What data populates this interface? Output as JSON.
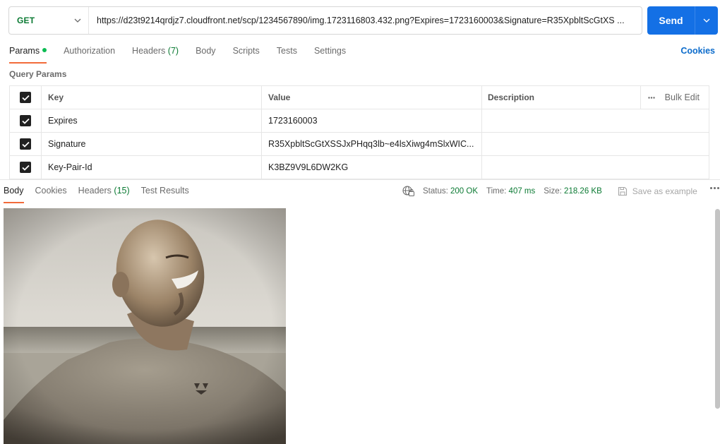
{
  "request": {
    "method": "GET",
    "url": "https://d23t9214qrdjz7.cloudfront.net/scp/1234567890/img.1723116803.432.png?Expires=1723160003&Signature=R35XpbltScGtXS ...",
    "send_label": "Send"
  },
  "request_tabs": [
    {
      "label": "Params",
      "active": true
    },
    {
      "label": "Authorization"
    },
    {
      "label": "Headers",
      "count": "(7)"
    },
    {
      "label": "Body"
    },
    {
      "label": "Scripts"
    },
    {
      "label": "Tests"
    },
    {
      "label": "Settings"
    }
  ],
  "cookies_label": "Cookies",
  "query_params": {
    "title": "Query Params",
    "headers": {
      "key": "Key",
      "value": "Value",
      "description": "Description",
      "bulk_edit": "Bulk Edit"
    },
    "rows": [
      {
        "key": "Expires",
        "value": "1723160003",
        "description": ""
      },
      {
        "key": "Signature",
        "value": "R35XpbltScGtXSSJxPHqq3lb~e4lsXiwg4mSlxWIC...",
        "description": ""
      },
      {
        "key": "Key-Pair-Id",
        "value": "K3BZ9V9L6DW2KG",
        "description": ""
      }
    ]
  },
  "response": {
    "tabs": [
      {
        "label": "Body",
        "active": true
      },
      {
        "label": "Cookies"
      },
      {
        "label": "Headers",
        "count": "(15)"
      },
      {
        "label": "Test Results"
      }
    ],
    "status_label": "Status:",
    "status_value": "200 OK",
    "time_label": "Time:",
    "time_value": "407 ms",
    "size_label": "Size:",
    "size_value": "218.26 KB",
    "save_example": "Save as example"
  },
  "colors": {
    "accent_blue": "#1470e5",
    "method_green": "#0b7a33",
    "tab_indicator": "#f26b3a",
    "link_blue": "#0b6bcb"
  }
}
